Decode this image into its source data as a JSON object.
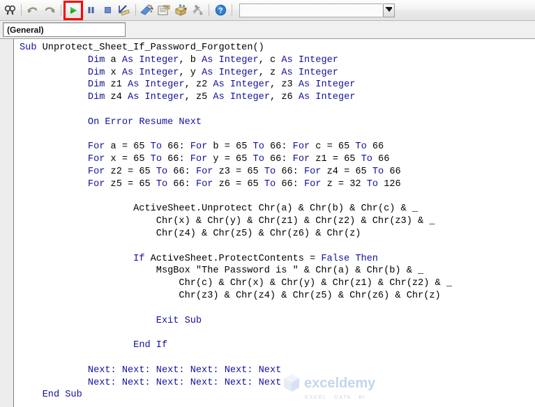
{
  "window": {
    "title": "Microsoft Visual Basic for Applications - Code Module"
  },
  "toolbar": {
    "buttons": [
      {
        "name": "find-icon",
        "label": "Find",
        "glyph": "binoculars"
      },
      {
        "name": "undo-icon",
        "label": "Undo",
        "glyph": "undo"
      },
      {
        "name": "redo-icon",
        "label": "Redo",
        "glyph": "redo"
      },
      {
        "name": "run-icon",
        "label": "Run Sub/UserForm",
        "glyph": "play"
      },
      {
        "name": "break-icon",
        "label": "Break",
        "glyph": "pause"
      },
      {
        "name": "reset-icon",
        "label": "Reset",
        "glyph": "stop"
      },
      {
        "name": "design-mode-icon",
        "label": "Design Mode",
        "glyph": "design"
      },
      {
        "name": "project-explorer-icon",
        "label": "Project Explorer",
        "glyph": "project"
      },
      {
        "name": "properties-window-icon",
        "label": "Properties Window",
        "glyph": "properties"
      },
      {
        "name": "object-browser-icon",
        "label": "Object Browser",
        "glyph": "objectbrowser"
      },
      {
        "name": "toolbox-icon",
        "label": "Toolbox",
        "glyph": "toolbox"
      },
      {
        "name": "help-icon",
        "label": "Help",
        "glyph": "help"
      }
    ],
    "highlight_button": "run-icon",
    "highlight_color": "#ff0000",
    "combo": {
      "value": "",
      "placeholder": ""
    }
  },
  "declaration_bar": {
    "object_combo": "(General)",
    "procedure_combo": ""
  },
  "editor": {
    "margin_indicator": "",
    "code_lines": [
      [
        {
          "t": "Sub ",
          "c": "kw"
        },
        {
          "t": "Unprotect_Sheet_If_Password_Forgotten()",
          "c": "pl"
        }
      ],
      [
        {
          "t": "            ",
          "c": "pl"
        },
        {
          "t": "Dim ",
          "c": "kw"
        },
        {
          "t": "a ",
          "c": "pl"
        },
        {
          "t": "As Integer",
          "c": "kw"
        },
        {
          "t": ", ",
          "c": "pl"
        },
        {
          "t": "b ",
          "c": "pl"
        },
        {
          "t": "As Integer",
          "c": "kw"
        },
        {
          "t": ", ",
          "c": "pl"
        },
        {
          "t": "c ",
          "c": "pl"
        },
        {
          "t": "As Integer",
          "c": "kw"
        }
      ],
      [
        {
          "t": "            ",
          "c": "pl"
        },
        {
          "t": "Dim ",
          "c": "kw"
        },
        {
          "t": "x ",
          "c": "pl"
        },
        {
          "t": "As Integer",
          "c": "kw"
        },
        {
          "t": ", ",
          "c": "pl"
        },
        {
          "t": "y ",
          "c": "pl"
        },
        {
          "t": "As Integer",
          "c": "kw"
        },
        {
          "t": ", ",
          "c": "pl"
        },
        {
          "t": "z ",
          "c": "pl"
        },
        {
          "t": "As Integer",
          "c": "kw"
        }
      ],
      [
        {
          "t": "            ",
          "c": "pl"
        },
        {
          "t": "Dim ",
          "c": "kw"
        },
        {
          "t": "z1 ",
          "c": "pl"
        },
        {
          "t": "As Integer",
          "c": "kw"
        },
        {
          "t": ", ",
          "c": "pl"
        },
        {
          "t": "z2 ",
          "c": "pl"
        },
        {
          "t": "As Integer",
          "c": "kw"
        },
        {
          "t": ", ",
          "c": "pl"
        },
        {
          "t": "z3 ",
          "c": "pl"
        },
        {
          "t": "As Integer",
          "c": "kw"
        }
      ],
      [
        {
          "t": "            ",
          "c": "pl"
        },
        {
          "t": "Dim ",
          "c": "kw"
        },
        {
          "t": "z4 ",
          "c": "pl"
        },
        {
          "t": "As Integer",
          "c": "kw"
        },
        {
          "t": ", ",
          "c": "pl"
        },
        {
          "t": "z5 ",
          "c": "pl"
        },
        {
          "t": "As Integer",
          "c": "kw"
        },
        {
          "t": ", ",
          "c": "pl"
        },
        {
          "t": "z6 ",
          "c": "pl"
        },
        {
          "t": "As Integer",
          "c": "kw"
        }
      ],
      [],
      [
        {
          "t": "            ",
          "c": "pl"
        },
        {
          "t": "On Error Resume Next",
          "c": "kw"
        }
      ],
      [],
      [
        {
          "t": "            ",
          "c": "pl"
        },
        {
          "t": "For ",
          "c": "kw"
        },
        {
          "t": "a = 65 ",
          "c": "pl"
        },
        {
          "t": "To ",
          "c": "kw"
        },
        {
          "t": "66: ",
          "c": "pl"
        },
        {
          "t": "For ",
          "c": "kw"
        },
        {
          "t": "b = 65 ",
          "c": "pl"
        },
        {
          "t": "To ",
          "c": "kw"
        },
        {
          "t": "66: ",
          "c": "pl"
        },
        {
          "t": "For ",
          "c": "kw"
        },
        {
          "t": "c = 65 ",
          "c": "pl"
        },
        {
          "t": "To ",
          "c": "kw"
        },
        {
          "t": "66",
          "c": "pl"
        }
      ],
      [
        {
          "t": "            ",
          "c": "pl"
        },
        {
          "t": "For ",
          "c": "kw"
        },
        {
          "t": "x = 65 ",
          "c": "pl"
        },
        {
          "t": "To ",
          "c": "kw"
        },
        {
          "t": "66: ",
          "c": "pl"
        },
        {
          "t": "For ",
          "c": "kw"
        },
        {
          "t": "y = 65 ",
          "c": "pl"
        },
        {
          "t": "To ",
          "c": "kw"
        },
        {
          "t": "66: ",
          "c": "pl"
        },
        {
          "t": "For ",
          "c": "kw"
        },
        {
          "t": "z1 = 65 ",
          "c": "pl"
        },
        {
          "t": "To ",
          "c": "kw"
        },
        {
          "t": "66",
          "c": "pl"
        }
      ],
      [
        {
          "t": "            ",
          "c": "pl"
        },
        {
          "t": "For ",
          "c": "kw"
        },
        {
          "t": "z2 = 65 ",
          "c": "pl"
        },
        {
          "t": "To ",
          "c": "kw"
        },
        {
          "t": "66: ",
          "c": "pl"
        },
        {
          "t": "For ",
          "c": "kw"
        },
        {
          "t": "z3 = 65 ",
          "c": "pl"
        },
        {
          "t": "To ",
          "c": "kw"
        },
        {
          "t": "66: ",
          "c": "pl"
        },
        {
          "t": "For ",
          "c": "kw"
        },
        {
          "t": "z4 = 65 ",
          "c": "pl"
        },
        {
          "t": "To ",
          "c": "kw"
        },
        {
          "t": "66",
          "c": "pl"
        }
      ],
      [
        {
          "t": "            ",
          "c": "pl"
        },
        {
          "t": "For ",
          "c": "kw"
        },
        {
          "t": "z5 = 65 ",
          "c": "pl"
        },
        {
          "t": "To ",
          "c": "kw"
        },
        {
          "t": "66: ",
          "c": "pl"
        },
        {
          "t": "For ",
          "c": "kw"
        },
        {
          "t": "z6 = 65 ",
          "c": "pl"
        },
        {
          "t": "To ",
          "c": "kw"
        },
        {
          "t": "66: ",
          "c": "pl"
        },
        {
          "t": "For ",
          "c": "kw"
        },
        {
          "t": "z = 32 ",
          "c": "pl"
        },
        {
          "t": "To ",
          "c": "kw"
        },
        {
          "t": "126",
          "c": "pl"
        }
      ],
      [],
      [
        {
          "t": "                    ActiveSheet.Unprotect Chr(a) & Chr(b) & Chr(c) & _",
          "c": "pl"
        }
      ],
      [
        {
          "t": "                        Chr(x) & Chr(y) & Chr(z1) & Chr(z2) & Chr(z3) & _",
          "c": "pl"
        }
      ],
      [
        {
          "t": "                        Chr(z4) & Chr(z5) & Chr(z6) & Chr(z)",
          "c": "pl"
        }
      ],
      [],
      [
        {
          "t": "                    ",
          "c": "pl"
        },
        {
          "t": "If ",
          "c": "kw"
        },
        {
          "t": "ActiveSheet.ProtectContents = ",
          "c": "pl"
        },
        {
          "t": "False Then",
          "c": "kw"
        }
      ],
      [
        {
          "t": "                        MsgBox \"The Password is \" & Chr(a) & Chr(b) & _",
          "c": "pl"
        }
      ],
      [
        {
          "t": "                            Chr(c) & Chr(x) & Chr(y) & Chr(z1) & Chr(z2) & _",
          "c": "pl"
        }
      ],
      [
        {
          "t": "                            Chr(z3) & Chr(z4) & Chr(z5) & Chr(z6) & Chr(z)",
          "c": "pl"
        }
      ],
      [],
      [
        {
          "t": "                        ",
          "c": "pl"
        },
        {
          "t": "Exit Sub",
          "c": "kw"
        }
      ],
      [],
      [
        {
          "t": "                    ",
          "c": "pl"
        },
        {
          "t": "End If",
          "c": "kw"
        }
      ],
      [],
      [
        {
          "t": "            ",
          "c": "pl"
        },
        {
          "t": "Next: Next: Next: Next: Next: Next",
          "c": "kw"
        }
      ],
      [
        {
          "t": "            ",
          "c": "pl"
        },
        {
          "t": "Next: Next: Next: Next: Next: Next",
          "c": "kw"
        }
      ],
      [
        {
          "t": "    ",
          "c": "pl"
        },
        {
          "t": "End Sub",
          "c": "kw"
        }
      ]
    ],
    "colors": {
      "keyword": "#12129e",
      "plain": "#000000",
      "background": "#ffffff"
    }
  },
  "watermark": {
    "name": "exceldemy",
    "tagline": "EXCEL · DATA · BI",
    "color": "#b9cde9"
  }
}
